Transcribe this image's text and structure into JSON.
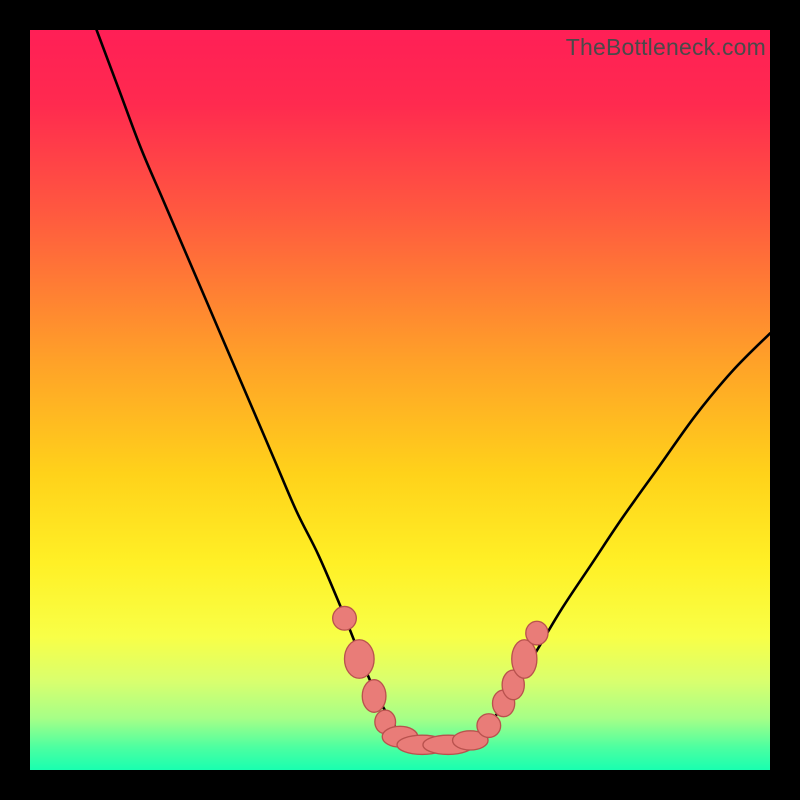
{
  "watermark": "TheBottleneck.com",
  "colors": {
    "black": "#000000",
    "gradient_stops": [
      {
        "offset": 0.0,
        "color": "#ff1f56"
      },
      {
        "offset": 0.1,
        "color": "#ff2a4f"
      },
      {
        "offset": 0.25,
        "color": "#ff5a3f"
      },
      {
        "offset": 0.45,
        "color": "#ffa228"
      },
      {
        "offset": 0.6,
        "color": "#ffd21a"
      },
      {
        "offset": 0.72,
        "color": "#fff026"
      },
      {
        "offset": 0.82,
        "color": "#f8ff47"
      },
      {
        "offset": 0.88,
        "color": "#d9ff6e"
      },
      {
        "offset": 0.93,
        "color": "#a6ff87"
      },
      {
        "offset": 0.97,
        "color": "#4bffa1"
      },
      {
        "offset": 1.0,
        "color": "#19ffb0"
      }
    ],
    "curve": "#000000",
    "marker_fill": "#e97c78",
    "marker_stroke": "#b9524e"
  },
  "chart_data": {
    "type": "line",
    "title": "",
    "xlabel": "",
    "ylabel": "",
    "xlim": [
      0,
      100
    ],
    "ylim": [
      0,
      100
    ],
    "grid": false,
    "legend": false,
    "description": "V-shaped bottleneck curve. Y axis is bottleneck percentage (0 = green/good at bottom, 100 = red/bad at top). X axis is component balance ratio. Curve reaches minimum (~y=3) near x≈55 with a flat bottom segment roughly x=48..62, then rises on both sides. Left arm reaches y=100 near x=9; right arm reaches y≈59 at x=100.",
    "series": [
      {
        "name": "bottleneck-curve",
        "x": [
          9,
          12,
          15,
          18,
          21,
          24,
          27,
          30,
          33,
          36,
          39,
          42,
          44,
          46,
          48,
          50,
          52,
          54,
          56,
          58,
          60,
          62,
          64,
          66,
          69,
          72,
          76,
          80,
          85,
          90,
          95,
          100
        ],
        "y": [
          100,
          92,
          84,
          77,
          70,
          63,
          56,
          49,
          42,
          35,
          29,
          22,
          17,
          12,
          8,
          5,
          3.5,
          3,
          3,
          3.2,
          4,
          6,
          9,
          12,
          17,
          22,
          28,
          34,
          41,
          48,
          54,
          59
        ]
      }
    ],
    "markers": [
      {
        "x": 42.5,
        "y": 20.5,
        "rx": 1.6,
        "ry": 1.6
      },
      {
        "x": 44.5,
        "y": 15.0,
        "rx": 2.0,
        "ry": 2.6
      },
      {
        "x": 46.5,
        "y": 10.0,
        "rx": 1.6,
        "ry": 2.2
      },
      {
        "x": 48.0,
        "y": 6.5,
        "rx": 1.4,
        "ry": 1.6
      },
      {
        "x": 50.0,
        "y": 4.5,
        "rx": 2.4,
        "ry": 1.4
      },
      {
        "x": 53.0,
        "y": 3.4,
        "rx": 3.4,
        "ry": 1.3
      },
      {
        "x": 56.5,
        "y": 3.4,
        "rx": 3.4,
        "ry": 1.3
      },
      {
        "x": 59.5,
        "y": 4.0,
        "rx": 2.4,
        "ry": 1.3
      },
      {
        "x": 62.0,
        "y": 6.0,
        "rx": 1.6,
        "ry": 1.6
      },
      {
        "x": 64.0,
        "y": 9.0,
        "rx": 1.5,
        "ry": 1.8
      },
      {
        "x": 65.3,
        "y": 11.5,
        "rx": 1.5,
        "ry": 2.0
      },
      {
        "x": 66.8,
        "y": 15.0,
        "rx": 1.7,
        "ry": 2.6
      },
      {
        "x": 68.5,
        "y": 18.5,
        "rx": 1.5,
        "ry": 1.6
      }
    ]
  }
}
